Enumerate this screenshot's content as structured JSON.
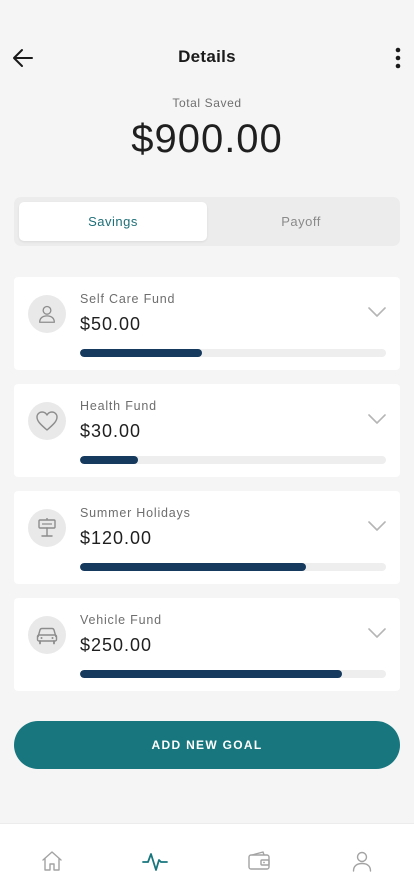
{
  "header": {
    "title": "Details",
    "back_icon": "arrow-left-icon",
    "more_icon": "kebab-vertical-icon"
  },
  "summary": {
    "label": "Total Saved",
    "value": "$900.00"
  },
  "tabs": [
    {
      "label": "Savings",
      "active": true
    },
    {
      "label": "Payoff",
      "active": false
    }
  ],
  "goals": [
    {
      "name": "Self Care Fund",
      "amount": "$50.00",
      "progress": 0.4,
      "icon": "person-icon"
    },
    {
      "name": "Health Fund",
      "amount": "$30.00",
      "progress": 0.19,
      "icon": "heart-icon"
    },
    {
      "name": "Summer Holidays",
      "amount": "$120.00",
      "progress": 0.74,
      "icon": "signpost-icon"
    },
    {
      "name": "Vehicle Fund",
      "amount": "$250.00",
      "progress": 0.855,
      "icon": "car-icon"
    }
  ],
  "add_button": {
    "label": "ADD NEW GOAL"
  },
  "nav": [
    {
      "icon": "home-icon",
      "active": false
    },
    {
      "icon": "activity-icon",
      "active": true
    },
    {
      "icon": "wallet-icon",
      "active": false
    },
    {
      "icon": "profile-icon",
      "active": false
    }
  ],
  "colors": {
    "accent": "#17767e",
    "progress": "#163a5e",
    "track": "#eeeeee",
    "background": "#f5f5f5",
    "nav_inactive": "#a3a3a3"
  }
}
